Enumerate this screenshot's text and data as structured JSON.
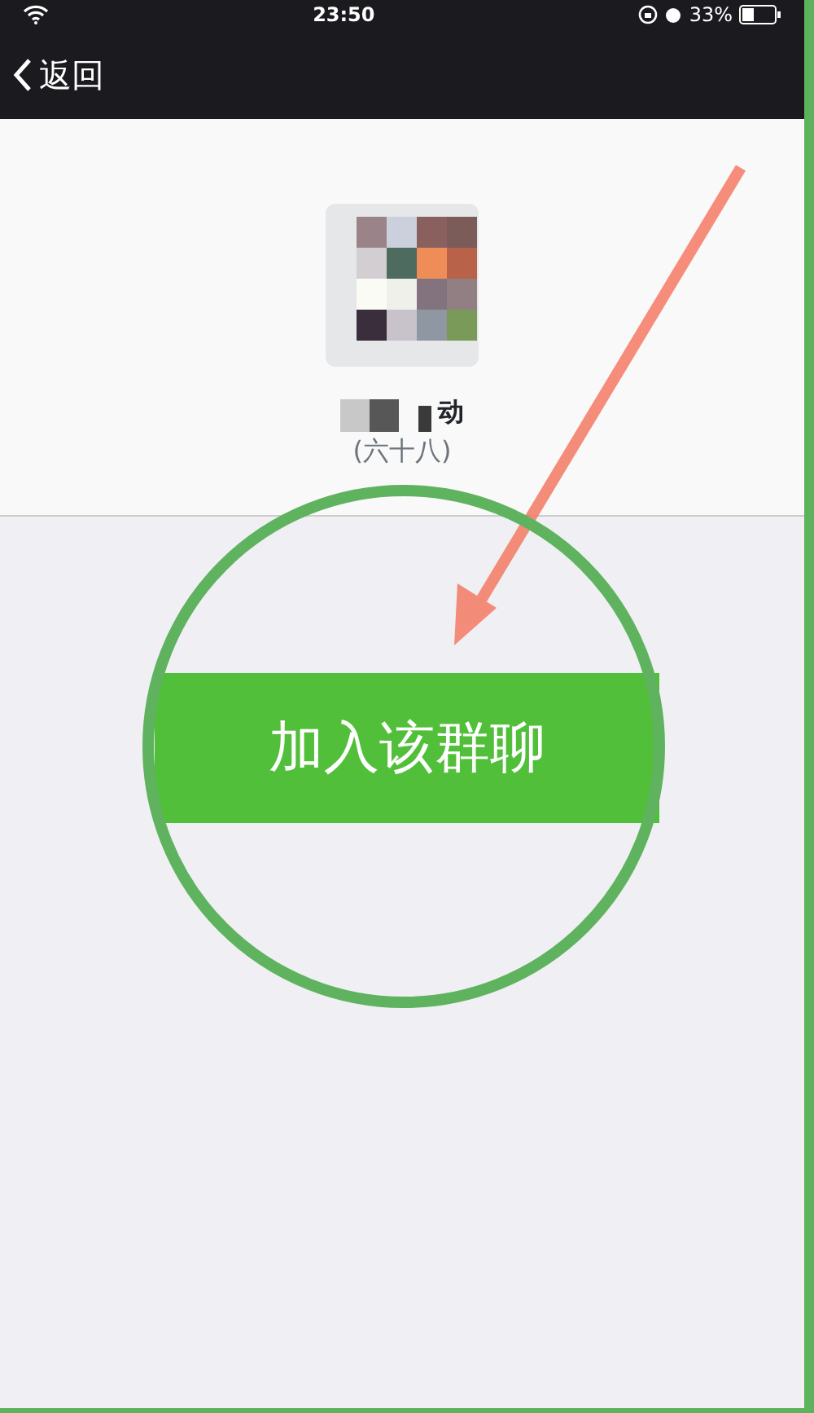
{
  "status_bar": {
    "time": "23:50",
    "battery": "33%"
  },
  "nav": {
    "back": "返回"
  },
  "group": {
    "name": "动",
    "member_count": "(六十八)"
  },
  "join_button": {
    "label": "加入该群聊"
  },
  "annotations": [
    {
      "kind": "arrow"
    },
    {
      "kind": "circle"
    }
  ]
}
